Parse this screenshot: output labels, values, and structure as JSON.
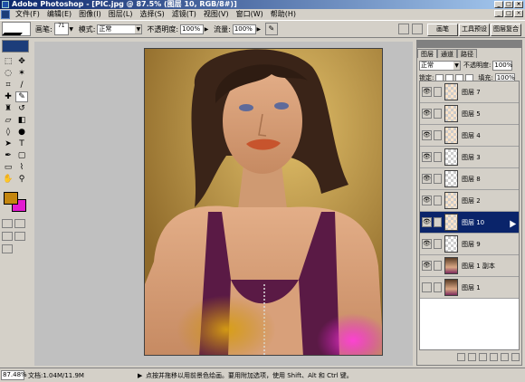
{
  "window": {
    "title": "Adobe Photoshop - [PIC.jpg @ 87.5% (图层 10, RGB/8#)]",
    "controls": [
      "_",
      "□",
      "×"
    ]
  },
  "menu": {
    "items": [
      "文件(F)",
      "编辑(E)",
      "图像(I)",
      "图层(L)",
      "选择(S)",
      "滤镜(T)",
      "视图(V)",
      "窗口(W)",
      "帮助(H)"
    ]
  },
  "options": {
    "brush_label": "画笔:",
    "brush_size": "71",
    "mode_label": "模式:",
    "mode_value": "正常",
    "opacity_label": "不透明度:",
    "opacity_value": "100%",
    "flow_label": "流量:",
    "flow_value": "100%"
  },
  "palette_well": {
    "tabs": [
      "画笔",
      "工具预设",
      "图层复合"
    ]
  },
  "swatches": {
    "foreground": "#c4860e",
    "background": "#e21bd0"
  },
  "layers": {
    "tabs": [
      "图层",
      "通道",
      "路径"
    ],
    "blend_mode": "正常",
    "opacity_label": "不透明度:",
    "opacity_value": "100%",
    "lock_label": "锁定:",
    "fill_label": "填充:",
    "fill_value": "100%",
    "items": [
      {
        "name": "图层 7",
        "thumb": "tint",
        "selected": false,
        "visible": true
      },
      {
        "name": "图层 5",
        "thumb": "tint",
        "selected": false,
        "visible": true
      },
      {
        "name": "图层 4",
        "thumb": "tint",
        "selected": false,
        "visible": true
      },
      {
        "name": "图层 3",
        "thumb": "trans",
        "selected": false,
        "visible": true
      },
      {
        "name": "图层 8",
        "thumb": "trans",
        "selected": false,
        "visible": true
      },
      {
        "name": "图层 2",
        "thumb": "tint",
        "selected": false,
        "visible": true
      },
      {
        "name": "图层 10",
        "thumb": "tint",
        "selected": true,
        "visible": true
      },
      {
        "name": "图层 9",
        "thumb": "trans",
        "selected": false,
        "visible": true
      },
      {
        "name": "图层 1 副本",
        "thumb": "photo",
        "selected": false,
        "visible": true
      },
      {
        "name": "图层 1",
        "thumb": "photo",
        "selected": false,
        "visible": false
      }
    ]
  },
  "status": {
    "zoom": "87.48%",
    "doc": "文档:1.04M/11.9M",
    "hint": "点按并拖移以用前景色绘画。要用附加选项，使用 Shift、Alt 和 Ctrl 键。"
  }
}
